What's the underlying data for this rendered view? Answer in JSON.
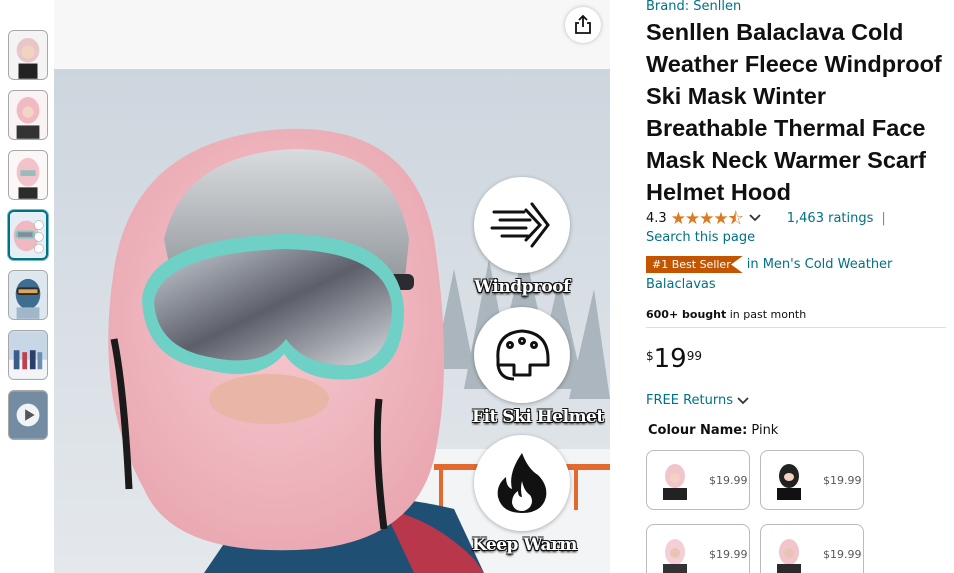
{
  "thumbnails": [
    {
      "name": "thumb-1",
      "active": false,
      "video": false,
      "accent": "#e9c6c9"
    },
    {
      "name": "thumb-2",
      "active": false,
      "video": false,
      "accent": "#f1b9c3"
    },
    {
      "name": "thumb-3",
      "active": false,
      "video": false,
      "accent": "#f3c3cb"
    },
    {
      "name": "thumb-4",
      "active": true,
      "video": false,
      "accent": "#f0b8c0"
    },
    {
      "name": "thumb-5",
      "active": false,
      "video": false,
      "accent": "#3e6d8f"
    },
    {
      "name": "thumb-6",
      "active": false,
      "video": false,
      "accent": "#9fb8cf"
    },
    {
      "name": "thumb-7",
      "active": false,
      "video": true,
      "accent": "#6f8ba3"
    }
  ],
  "features": [
    {
      "label": "Windproof",
      "icon": "wind-icon"
    },
    {
      "label": "Fit Ski Helmet",
      "icon": "helmet-icon"
    },
    {
      "label": "Keep Warm",
      "icon": "flame-icon"
    }
  ],
  "product": {
    "brand": "Brand: Senllen",
    "title": "Senllen Balaclava Cold Weather Fleece Windproof Ski Mask Winter Breathable Thermal Face Mask Neck Warmer Scarf Helmet Hood",
    "rating": "4.3",
    "stars": "★★★★⯪",
    "ratings_count": "1,463 ratings",
    "pipe": "|",
    "search_link": "Search this page",
    "best_seller_badge": "#1 Best Seller",
    "best_seller_category": "in Men's Cold Weather Balaclavas",
    "bought_bold": "600+ bought",
    "bought_rest": " in past month",
    "price_symbol": "$",
    "price_whole": "19",
    "price_fraction": "99",
    "returns": "FREE Returns",
    "colour_label": "Colour Name:",
    "colour_value": "Pink"
  },
  "swatches": [
    {
      "price": "$19.99",
      "color": "#f2c4cc"
    },
    {
      "price": "$19.99",
      "color": "#222222"
    },
    {
      "price": "$19.99",
      "color": "#f4d0d6"
    },
    {
      "price": "$19.99",
      "color": "#f2c4cc"
    }
  ],
  "colors": {
    "link": "#007185",
    "badge": "#C45500",
    "star": "#DE7921",
    "active_thumb": "#007185"
  }
}
